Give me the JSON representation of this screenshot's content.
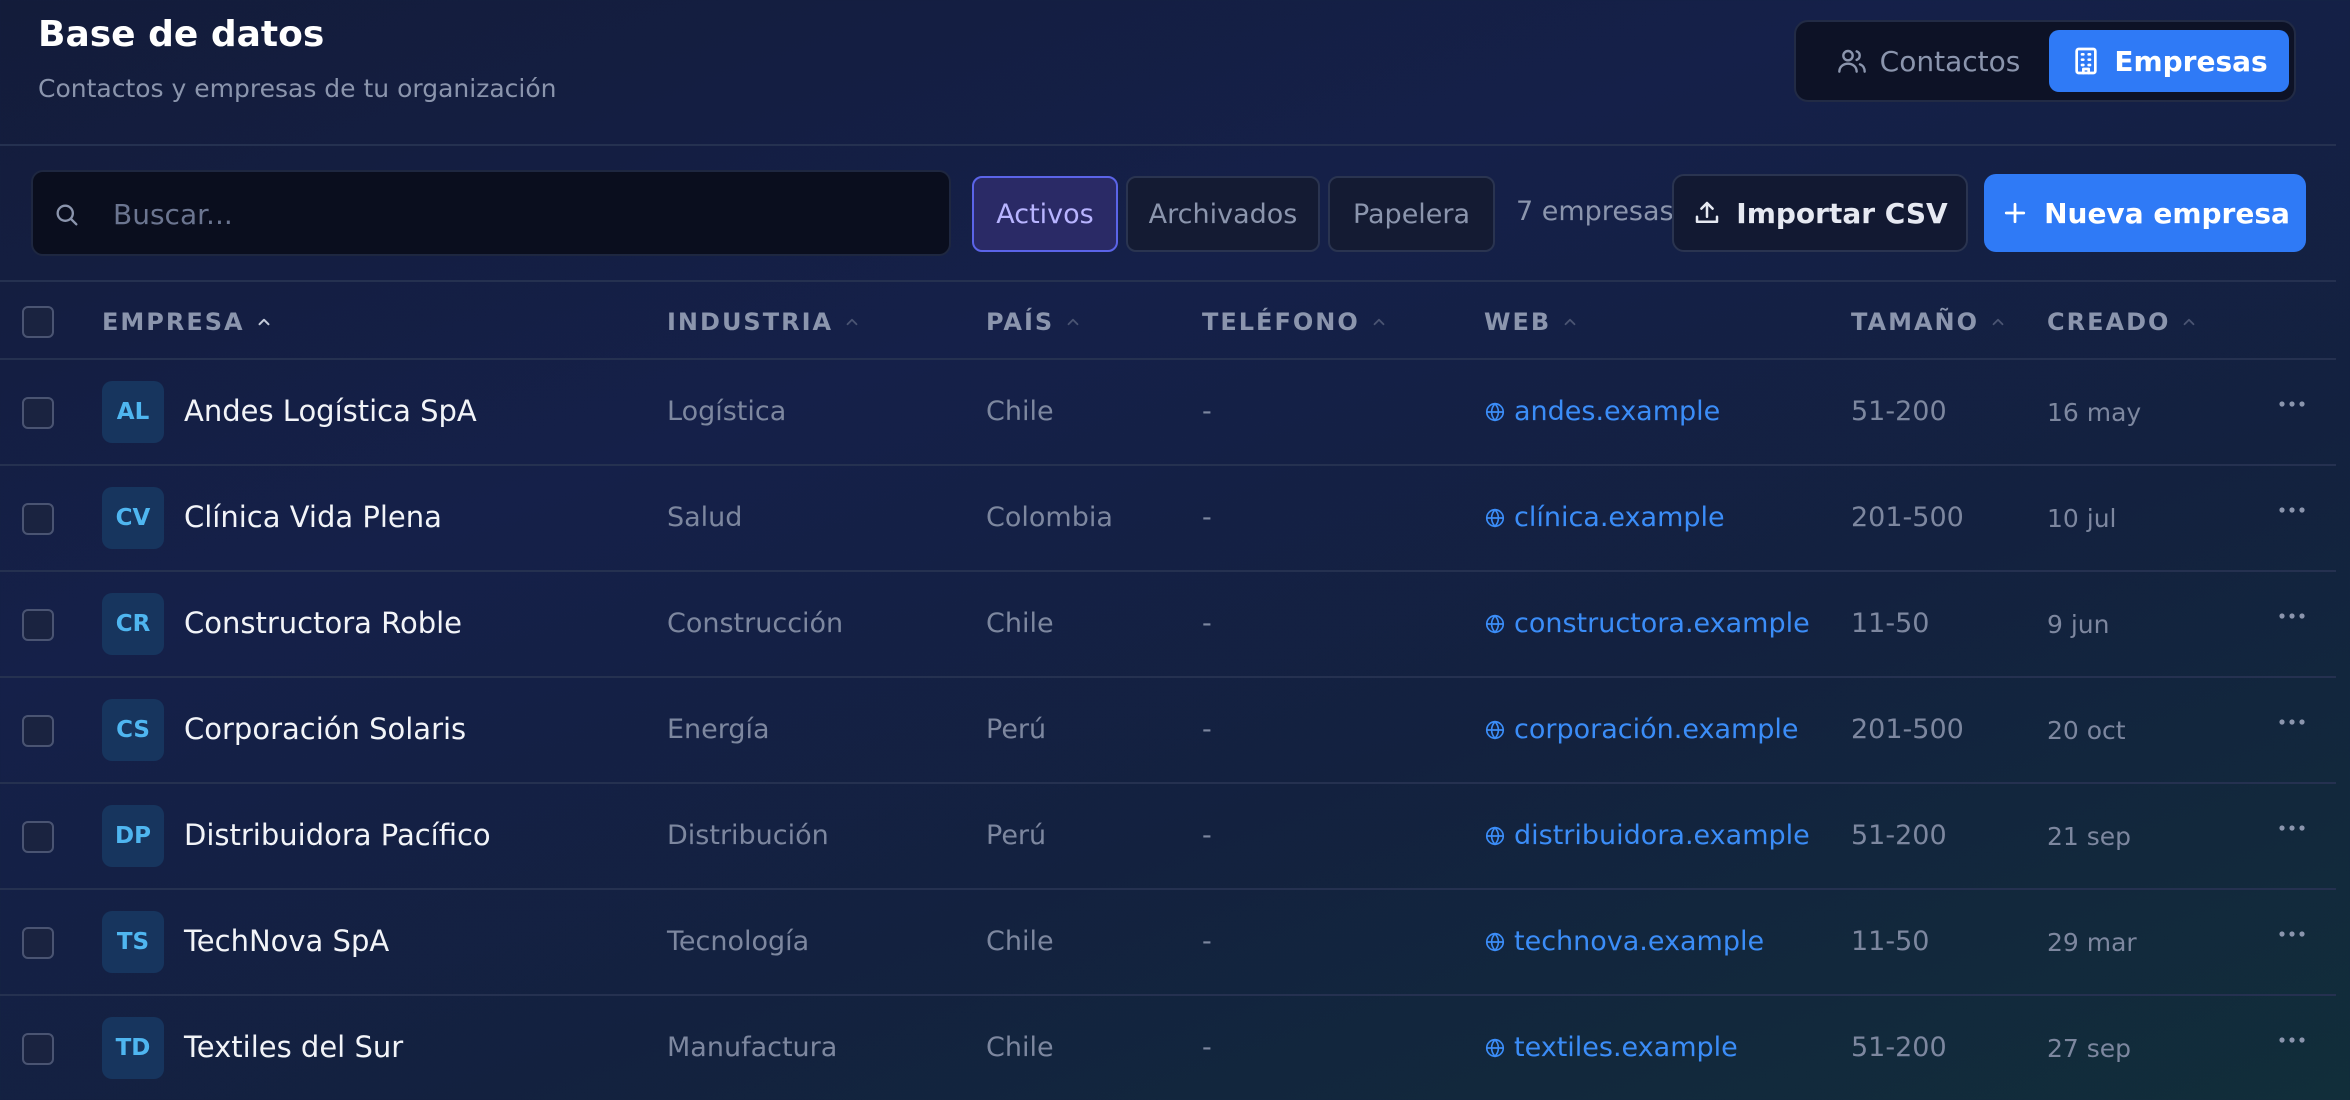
{
  "header": {
    "title": "Base de datos",
    "subtitle": "Contactos y empresas de tu organización",
    "toggle": {
      "contactos": "Contactos",
      "empresas": "Empresas",
      "active": "empresas"
    }
  },
  "toolbar": {
    "search_placeholder": "Buscar...",
    "search_value": "",
    "filters": {
      "activos": "Activos",
      "archivados": "Archivados",
      "papelera": "Papelera",
      "active": "activos"
    },
    "count": "7 empresas",
    "import_label": "Importar CSV",
    "new_label": "Nueva empresa"
  },
  "table": {
    "columns": {
      "empresa": "EMPRESA",
      "industria": "INDUSTRIA",
      "pais": "PAÍS",
      "telefono": "TELÉFONO",
      "web": "WEB",
      "tamano": "TAMAÑO",
      "creado": "CREADO"
    },
    "rows": [
      {
        "initials": "AL",
        "name": "Andes Logística SpA",
        "industry": "Logística",
        "country": "Chile",
        "phone": "-",
        "web": "andes.example",
        "size": "51-200",
        "created": "16 may"
      },
      {
        "initials": "CV",
        "name": "Clínica Vida Plena",
        "industry": "Salud",
        "country": "Colombia",
        "phone": "-",
        "web": "clínica.example",
        "size": "201-500",
        "created": "10 jul"
      },
      {
        "initials": "CR",
        "name": "Constructora Roble",
        "industry": "Construcción",
        "country": "Chile",
        "phone": "-",
        "web": "constructora.example",
        "size": "11-50",
        "created": "9 jun"
      },
      {
        "initials": "CS",
        "name": "Corporación Solaris",
        "industry": "Energía",
        "country": "Perú",
        "phone": "-",
        "web": "corporación.example",
        "size": "201-500",
        "created": "20 oct"
      },
      {
        "initials": "DP",
        "name": "Distribuidora Pacífico",
        "industry": "Distribución",
        "country": "Perú",
        "phone": "-",
        "web": "distribuidora.example",
        "size": "51-200",
        "created": "21 sep"
      },
      {
        "initials": "TS",
        "name": "TechNova SpA",
        "industry": "Tecnología",
        "country": "Chile",
        "phone": "-",
        "web": "technova.example",
        "size": "11-50",
        "created": "29 mar"
      },
      {
        "initials": "TD",
        "name": "Textiles del Sur",
        "industry": "Manufactura",
        "country": "Chile",
        "phone": "-",
        "web": "textiles.example",
        "size": "51-200",
        "created": "27 sep"
      }
    ]
  },
  "colors": {
    "accent": "#2f7af6",
    "filter_active": "#5b64e8",
    "link": "#3b8df8",
    "avatar_text": "#4fb6f0"
  },
  "icons": {
    "contactos": "users-icon",
    "empresas": "building-icon",
    "search": "search-icon",
    "import": "upload-icon",
    "new": "plus-icon",
    "web": "globe-icon",
    "row_menu": "more-horizontal-icon",
    "sort": "chevron-up-icon"
  }
}
